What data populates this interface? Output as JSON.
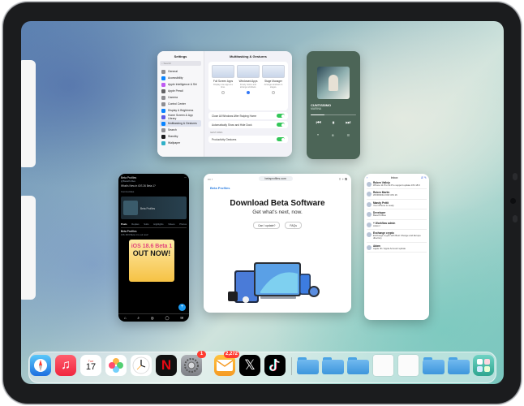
{
  "settings": {
    "title": "Settings",
    "search_placeholder": "Search",
    "sidebar": [
      "General",
      "Accessibility",
      "Apple Intelligence & Siri",
      "Apple Pencil",
      "Camera",
      "Control Center",
      "Display & Brightness",
      "Home Screen & App Library",
      "Multitasking & Gestures",
      "Search",
      "Standby",
      "Wallpaper"
    ],
    "panel_title": "Multitasking & Gestures",
    "options": [
      {
        "label": "Full Screen Apps",
        "desc": "Display one app at a time."
      },
      {
        "label": "Windowed Apps",
        "desc": "Freely resize and arrange windows."
      },
      {
        "label": "Stage Manager",
        "desc": "Arrange windows in stages."
      }
    ],
    "rows": [
      "Close All Windows After Swiping Home",
      "Automatically Show and Hide Dock"
    ],
    "gestures_header": "GESTURES",
    "gestures_row": "Productivity Gestures"
  },
  "music": {
    "title": "CUNTISSIMO",
    "artist": "MARINA",
    "controls": [
      "⏮",
      "⏸",
      "⏭"
    ],
    "bottom": [
      "❝",
      "⊚",
      "☰"
    ]
  },
  "twitter": {
    "account": "Beta Profiles",
    "handle": "@BetaProfiles",
    "tweet": "What's New in iOS 26 Beta 1?",
    "community_label": "Communities",
    "card_title": "Beta Profiles",
    "tabs": [
      "Posts",
      "Replies",
      "Subs",
      "Highlights",
      "Videos",
      "Photos"
    ],
    "post_author": "Beta Profiles",
    "post_text": "iOS 18.6 Beta 1 is out now!",
    "poster_line1": "iOS 18.6 Beta 1",
    "poster_line2": "OUT NOW!",
    "nav_icons": [
      "⌂",
      "⌕",
      "◎",
      "◯",
      "✉"
    ],
    "fab": "+"
  },
  "safari": {
    "url": "betaprofiles.com",
    "brand": "Beta Profiles",
    "heading": "Download Beta Software",
    "subheading": "Get what's next, now.",
    "btn1": "Can I update?",
    "btn2": "FAQs",
    "icons_left": "▭ ‹",
    "icons_right": "⇧ + ⧉"
  },
  "mail": {
    "title": "Inbox",
    "back": "‹",
    "icons": "⇵ ✎",
    "messages": [
      {
        "from": "Ruben Vallejo",
        "subject": "iPhone 11 Pro 14 Pro support update iOS 18.6"
      },
      {
        "from": "Ruben Martin",
        "subject": "WORKING FOR iOS 16"
      },
      {
        "from": "Mandy Pettit",
        "subject": "Your iPhone is ready"
      },
      {
        "from": "Developer",
        "subject": "Beta Profiles"
      },
      {
        "from": "+ Workflow admin",
        "subject": "Action!"
      },
      {
        "from": "Exchange crypto",
        "subject": "Exchange crypto with Best Change and Europe directory"
      },
      {
        "from": "Adam",
        "subject": "Apple ID / Apple Account update"
      }
    ]
  },
  "dock": {
    "apps": [
      "Safari",
      "Music",
      "Calendar",
      "Photos",
      "Clock",
      "Netflix",
      "Settings",
      "Mail",
      "X",
      "TikTok"
    ],
    "calendar_day": "Tue",
    "calendar_date": "17",
    "settings_badge": "1",
    "mail_badge": "2,272"
  },
  "colors": {
    "accent": "#3478f6",
    "music_bg": "#4c6557",
    "badge": "#ff3b30"
  }
}
